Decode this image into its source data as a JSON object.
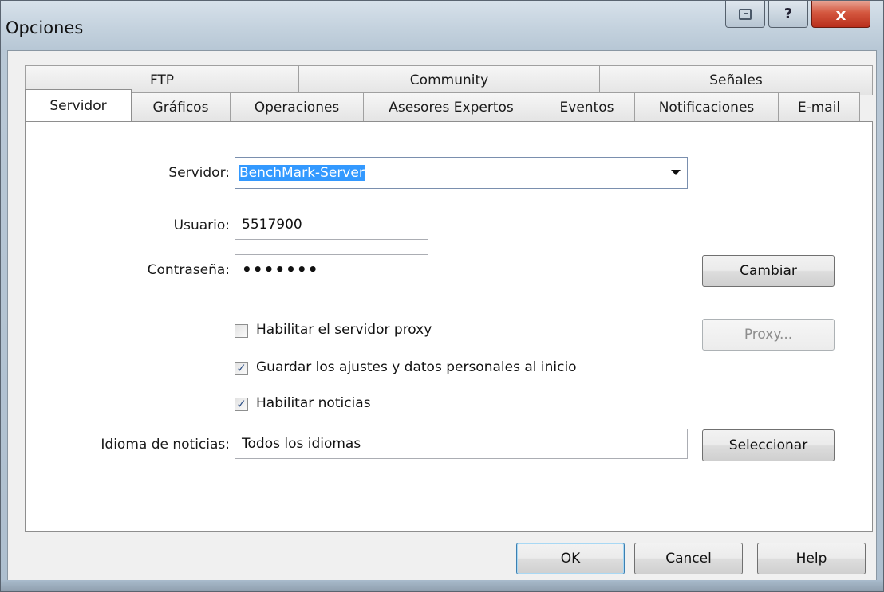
{
  "window": {
    "title": "Opciones",
    "help_glyph": "?",
    "close_glyph": "x"
  },
  "tabs": {
    "back_row": [
      "FTP",
      "Community",
      "Señales"
    ],
    "front_row": [
      "Servidor",
      "Gráficos",
      "Operaciones",
      "Asesores Expertos",
      "Eventos",
      "Notificaciones",
      "E-mail"
    ],
    "active": "Servidor"
  },
  "form": {
    "server_label": "Servidor:",
    "server_value": "BenchMark-Server",
    "user_label": "Usuario:",
    "user_value": "5517900",
    "password_label": "Contraseña:",
    "password_value": "•••••••",
    "change_button": "Cambiar",
    "proxy_checkbox": {
      "label": "Habilitar el servidor proxy",
      "checked": false
    },
    "proxy_button": "Proxy...",
    "save_checkbox": {
      "label": "Guardar los ajustes y datos personales al inicio",
      "checked": true
    },
    "news_checkbox": {
      "label": "Habilitar noticias",
      "checked": true
    },
    "news_language_label": "Idioma de noticias:",
    "news_language_value": "Todos los idiomas",
    "select_button": "Seleccionar"
  },
  "footer": {
    "ok": "OK",
    "cancel": "Cancel",
    "help": "Help"
  },
  "icons": {
    "context_help": "context-help-icon",
    "check": "✓",
    "dropdown": "chevron-down-icon"
  },
  "colors": {
    "selection": "#3399ff",
    "close_button": "#c8432c",
    "titlebar": "#c4d2de"
  }
}
